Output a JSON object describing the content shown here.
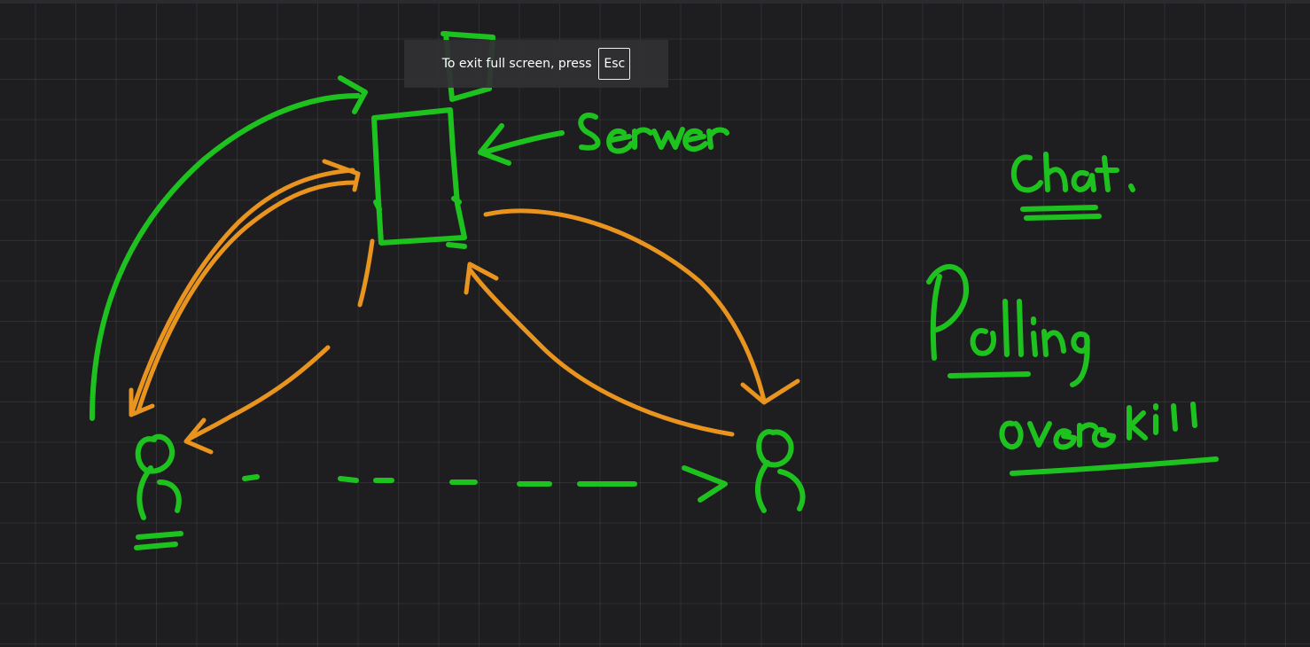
{
  "toast": {
    "message": "To exit full screen, press",
    "key": "Esc"
  },
  "colors": {
    "background": "#1e1e21",
    "green_ink": "#1ec21e",
    "orange_ink": "#e8941e"
  },
  "icons": {
    "server": "rectangle-box",
    "client_left": "stick-person",
    "client_right": "stick-person"
  },
  "handwriting": [
    "Server",
    "Chat.",
    "Polling",
    "overkill"
  ]
}
